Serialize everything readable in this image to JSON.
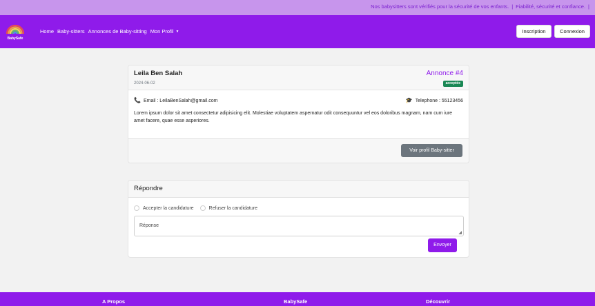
{
  "topbar": {
    "message1": "Nos babysitters sont vérifiés pour la sécurité de vos enfants.",
    "separator": "|",
    "message2": "Fiabilité, sécurité et confiance."
  },
  "navbar": {
    "logo_text": "BabySafe",
    "links": [
      "Home",
      "Baby-sitters",
      "Annonces de Baby-sitting",
      "Mon Profil"
    ],
    "inscription": "Inscription",
    "connexion": "Connexion"
  },
  "candidature": {
    "name": "Leila Ben Salah",
    "date": "2024-06-02",
    "annonce": "Annonce #4",
    "status": "acceptée",
    "email": "Email : LeilaBenSalah@gmail.com",
    "phone": "Telephone : 55123456",
    "description": "Lorem ipsum dolor sit amet consectetur adipisicing elit. Molestiae voluptatem aspernatur odit consequuntur vel eos doloribus magnam, nam cum iure amet facere, quae esse asperiores.",
    "profile_button": "Voir profil Baby-sitter"
  },
  "reponse": {
    "title": "Répondre",
    "accept_label": "Accepter la candidature",
    "refuse_label": "Refuser la candidature",
    "placeholder": "Réponse",
    "send_button": "Envoyer"
  },
  "footer": {
    "col1": "A Propos",
    "col2": "BabySafe",
    "col3": "Découvrir"
  },
  "colors": {
    "brand": "#8f1bea",
    "topbar": "#c795ec",
    "success": "#198754",
    "secondary": "#6c757d"
  }
}
